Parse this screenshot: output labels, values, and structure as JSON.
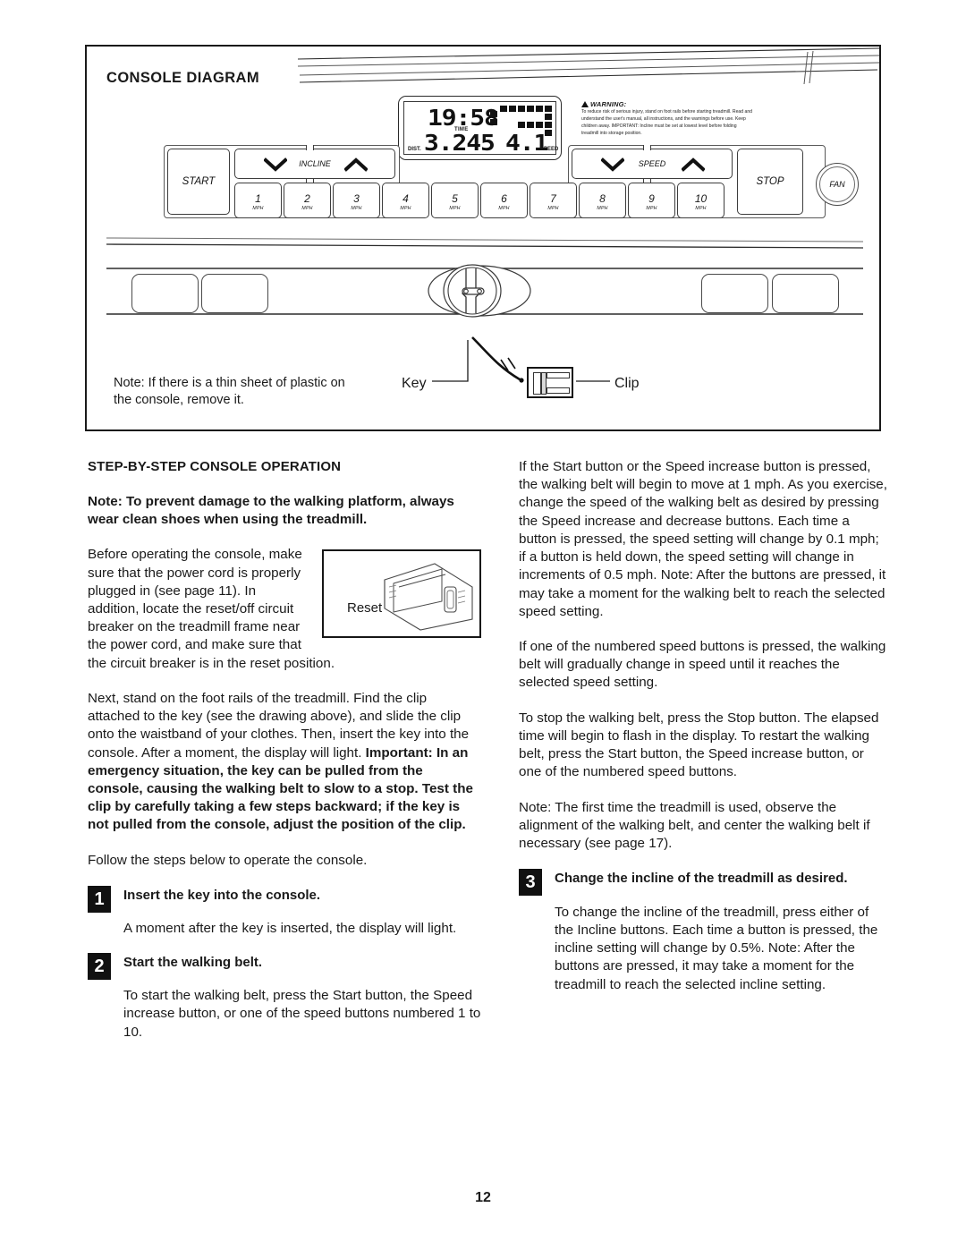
{
  "diagram": {
    "title": "CONSOLE DIAGRAM",
    "lcd": {
      "time_value": "19:58",
      "time_label": "TIME",
      "dist_label": "DIST.",
      "dist_value": "3.245",
      "speed_value": "4.1",
      "speed_label": "SPEED"
    },
    "warning": {
      "heading": "WARNING:",
      "body": "To reduce risk of serious injury, stand on foot rails before starting treadmill. Read and understand the user's manual, all instructions, and the warnings before use. Keep children away. IMPORTANT: Incline must be set at lowest level before folding treadmill into storage position."
    },
    "buttons": {
      "start": "START",
      "stop": "STOP",
      "fan": "FAN",
      "incline": "INCLINE",
      "speed": "SPEED"
    },
    "speed_keys": [
      {
        "number": "1",
        "unit": "MPH"
      },
      {
        "number": "2",
        "unit": "MPH"
      },
      {
        "number": "3",
        "unit": "MPH"
      },
      {
        "number": "4",
        "unit": "MPH"
      },
      {
        "number": "5",
        "unit": "MPH"
      },
      {
        "number": "6",
        "unit": "MPH"
      },
      {
        "number": "7",
        "unit": "MPH"
      },
      {
        "number": "8",
        "unit": "MPH"
      },
      {
        "number": "9",
        "unit": "MPH"
      },
      {
        "number": "10",
        "unit": "MPH"
      }
    ],
    "callouts": {
      "key": "Key",
      "clip": "Clip",
      "note": "Note: If there is a thin sheet of plastic on the console, remove it."
    }
  },
  "left_column": {
    "heading": "STEP-BY-STEP CONSOLE OPERATION",
    "note_bold": "Note: To prevent damage to the walking platform, always wear clean shoes when using the treadmill.",
    "para_before_1": "Before operating the console, make sure that the power cord is properly plugged in (see page 11). In addition, locate the reset/off circuit breaker on the treadmill frame near the power cord, and make sure that the circuit breaker is in the reset position.",
    "reset_figure_label": "Reset",
    "para_next_plain": "Next, stand on the foot rails of the treadmill. Find the clip attached to the key (see the drawing above), and slide the clip onto the waistband of your clothes. Then, insert the key into the console. After a moment, the display will light. ",
    "para_next_bold": "Important: In an emergency situation, the key can be pulled from the console, causing the walking belt to slow to a stop. Test the clip by carefully taking a few steps backward; if the key is not pulled from the console, adjust the position of the clip.",
    "para_follow": "Follow the steps below to operate the console.",
    "steps": [
      {
        "number": "1",
        "title": "Insert the key into the console.",
        "body": "A moment after the key is inserted, the display will light."
      },
      {
        "number": "2",
        "title": "Start the walking belt.",
        "body": "To start the walking belt, press the Start button, the Speed increase button, or one of the speed buttons numbered 1 to 10."
      }
    ]
  },
  "right_column": {
    "para_1": "If the Start button or the Speed increase button is pressed, the walking belt will begin to move at 1 mph. As you exercise, change the speed of the walking belt as desired by pressing the Speed increase and decrease buttons. Each time a button is pressed, the speed setting will change by 0.1 mph; if a button is held down, the speed setting will change in increments of 0.5 mph. Note: After the buttons are pressed, it may take a moment for the walking belt to reach the selected speed setting.",
    "para_2": "If one of the numbered speed buttons is pressed, the walking belt will gradually change in speed until it reaches the selected speed setting.",
    "para_3": "To stop the walking belt, press the Stop button. The elapsed time will begin to flash in the display. To restart the walking belt, press the Start button, the Speed increase button, or one of the numbered speed buttons.",
    "para_4": "Note: The first time the treadmill is used, observe the alignment of the walking belt, and center the walking belt if necessary (see page 17).",
    "steps": [
      {
        "number": "3",
        "title": "Change the incline of the treadmill as desired.",
        "body": "To change the incline of the treadmill, press either of the Incline buttons. Each time a button is pressed, the incline setting will change by 0.5%. Note: After the buttons are pressed, it may take a moment for the treadmill to reach the selected incline setting."
      }
    ]
  },
  "footer": {
    "page_number": "12"
  }
}
